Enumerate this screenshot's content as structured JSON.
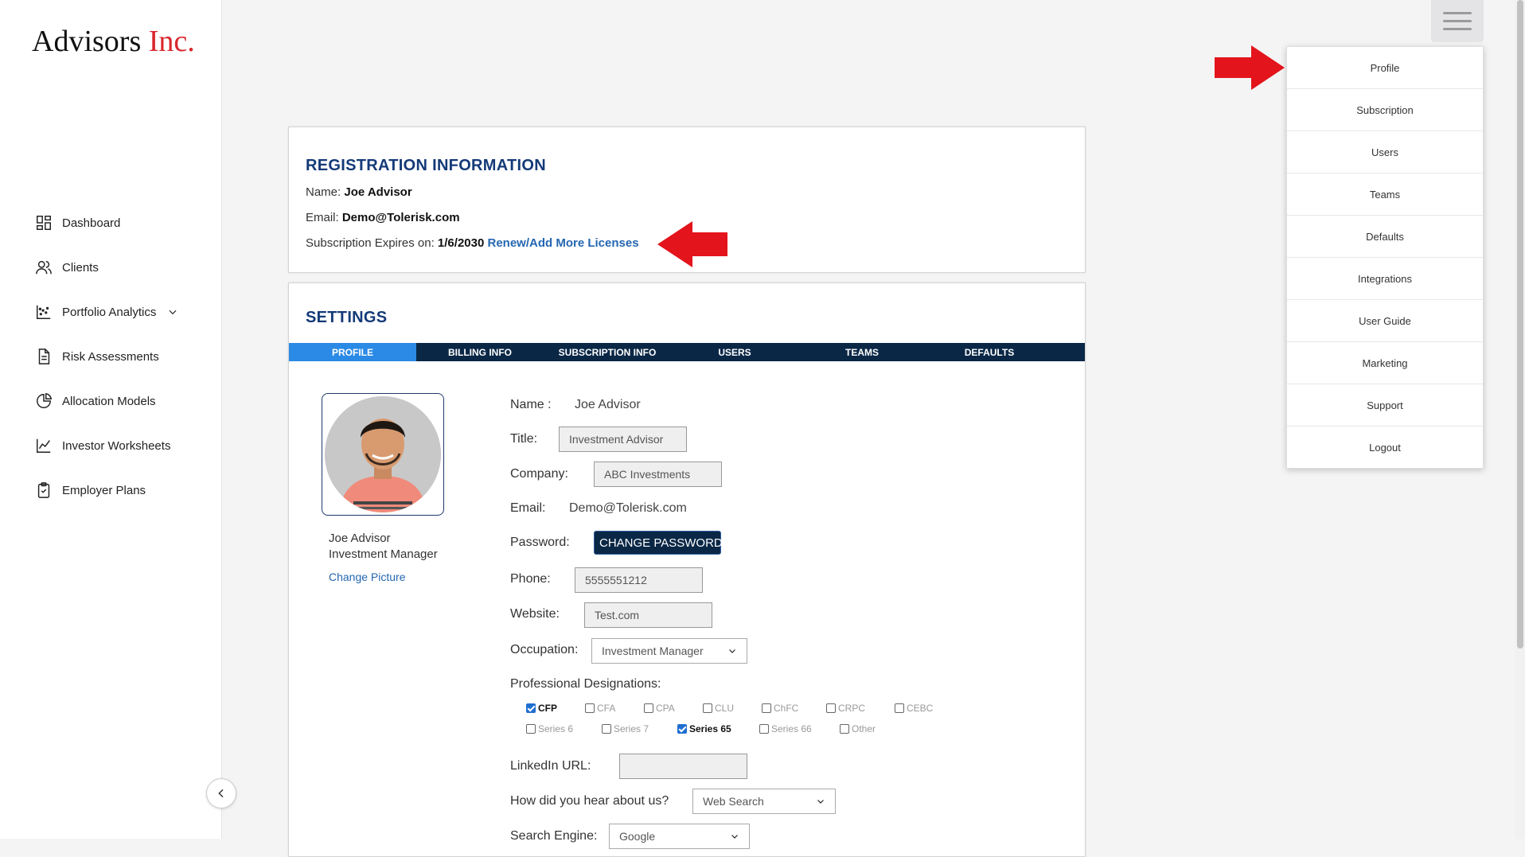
{
  "brand": {
    "name": "Advisors ",
    "accent": "Inc."
  },
  "sidebar": {
    "items": [
      {
        "label": "Dashboard",
        "icon": "dashboard-icon"
      },
      {
        "label": "Clients",
        "icon": "users-icon"
      },
      {
        "label": "Portfolio Analytics",
        "icon": "scatter-chart-icon"
      },
      {
        "label": "Risk Assessments",
        "icon": "document-icon"
      },
      {
        "label": "Allocation Models",
        "icon": "pie-chart-icon"
      },
      {
        "label": "Investor Worksheets",
        "icon": "line-chart-icon"
      },
      {
        "label": "Employer Plans",
        "icon": "clipboard-icon"
      }
    ]
  },
  "menu": {
    "items": [
      "Profile",
      "Subscription",
      "Users",
      "Teams",
      "Defaults",
      "Integrations",
      "User Guide",
      "Marketing",
      "Support",
      "Logout"
    ]
  },
  "registration": {
    "title": "REGISTRATION INFORMATION",
    "name_label": "Name: ",
    "name_value": "Joe Advisor",
    "email_label": "Email: ",
    "email_value": "Demo@Tolerisk.com",
    "expires_label": "Subscription Expires on: ",
    "expires_value": "1/6/2030",
    "renew_link": "Renew/Add More Licenses"
  },
  "settings": {
    "title": "SETTINGS",
    "tabs": [
      "PROFILE",
      "BILLING INFO",
      "SUBSCRIPTION INFO",
      "USERS",
      "TEAMS",
      "DEFAULTS"
    ],
    "active_tab": "PROFILE",
    "profile": {
      "display_name": "Joe Advisor",
      "display_title": "Investment Manager",
      "change_picture": "Change Picture",
      "name_label": "Name :",
      "name_value": "Joe Advisor",
      "title_label": "Title:",
      "title_value": "Investment Advisor",
      "company_label": "Company:",
      "company_value": "ABC Investments",
      "email_label": "Email:",
      "email_value": "Demo@Tolerisk.com",
      "password_label": "Password:",
      "change_password": "CHANGE PASSWORD",
      "phone_label": "Phone:",
      "phone_value": "5555551212",
      "website_label": "Website:",
      "website_value": "Test.com",
      "occupation_label": "Occupation:",
      "occupation_value": "Investment Manager",
      "designations_label": "Professional Designations:",
      "designations_row1": [
        {
          "label": "CFP",
          "checked": true
        },
        {
          "label": "CFA",
          "checked": false
        },
        {
          "label": "CPA",
          "checked": false
        },
        {
          "label": "CLU",
          "checked": false
        },
        {
          "label": "ChFC",
          "checked": false
        },
        {
          "label": "CRPC",
          "checked": false
        },
        {
          "label": "CEBC",
          "checked": false
        }
      ],
      "designations_row2": [
        {
          "label": "Series 6",
          "checked": false
        },
        {
          "label": "Series 7",
          "checked": false
        },
        {
          "label": "Series 65",
          "checked": true
        },
        {
          "label": "Series 66",
          "checked": false
        },
        {
          "label": "Other",
          "checked": false
        }
      ],
      "linkedin_label": "LinkedIn URL:",
      "linkedin_value": "",
      "hear_label": "How did you hear about us?",
      "hear_value": "Web Search",
      "search_engine_label": "Search Engine:",
      "search_engine_value": "Google"
    }
  },
  "colors": {
    "accent_red": "#d9262c",
    "navy": "#0a2746",
    "active_tab": "#2b8ae6",
    "heading": "#143a78"
  }
}
